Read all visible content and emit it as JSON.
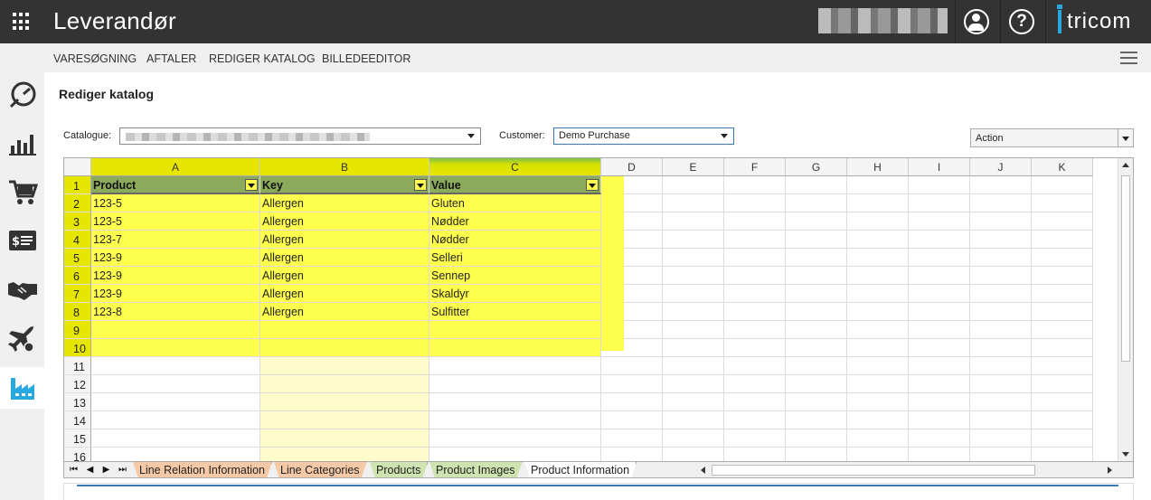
{
  "header": {
    "app_title": "Leverandør",
    "brand": "tricom"
  },
  "icons": {
    "apps": "grid-icon",
    "user": "user-circle-icon",
    "help": "help-circle-icon"
  },
  "subnav": {
    "items": [
      "VARESØGNING",
      "AFTALER",
      "REDIGER KATALOG",
      "BILLEDEEDITOR"
    ]
  },
  "sidebar": {
    "items": [
      "dashboard-gauge-icon",
      "bar-chart-icon",
      "shopping-cart-icon",
      "invoice-icon",
      "handshake-icon",
      "airplane-icon",
      "factory-icon"
    ],
    "active": "factory-icon"
  },
  "page": {
    "title": "Rediger katalog"
  },
  "filters": {
    "catalogue_label": "Catalogue:",
    "customer_label": "Customer:",
    "customer_value": "Demo Purchase",
    "action_label": "Action"
  },
  "sheet": {
    "columns": [
      "A",
      "B",
      "C",
      "D",
      "E",
      "F",
      "G",
      "H",
      "I",
      "J",
      "K"
    ],
    "rows": [
      "1",
      "2",
      "3",
      "4",
      "5",
      "6",
      "7",
      "8",
      "9",
      "10",
      "11",
      "12",
      "13",
      "14",
      "15",
      "16"
    ],
    "headers": [
      "Product",
      "Key",
      "Value"
    ],
    "data": [
      [
        "123-5",
        "Allergen",
        "Gluten"
      ],
      [
        "123-5",
        "Allergen",
        "Nødder"
      ],
      [
        "123-7",
        "Allergen",
        "Nødder"
      ],
      [
        "123-9",
        "Allergen",
        "Selleri"
      ],
      [
        "123-9",
        "Allergen",
        "Sennep"
      ],
      [
        "123-9",
        "Allergen",
        "Skaldyr"
      ],
      [
        "123-8",
        "Allergen",
        "Sulfitter"
      ]
    ],
    "tabs": [
      "Line Relation Information",
      "Line Categories",
      "Products",
      "Product Images",
      "Product Information"
    ],
    "active_tab": "Product Information"
  },
  "colors": {
    "topbar": "#333333",
    "brand_accent": "#29a8e0",
    "highlight": "#ffff4d",
    "header_row": "#8caa5c",
    "sidebar_active_icon": "#29a8e0"
  }
}
